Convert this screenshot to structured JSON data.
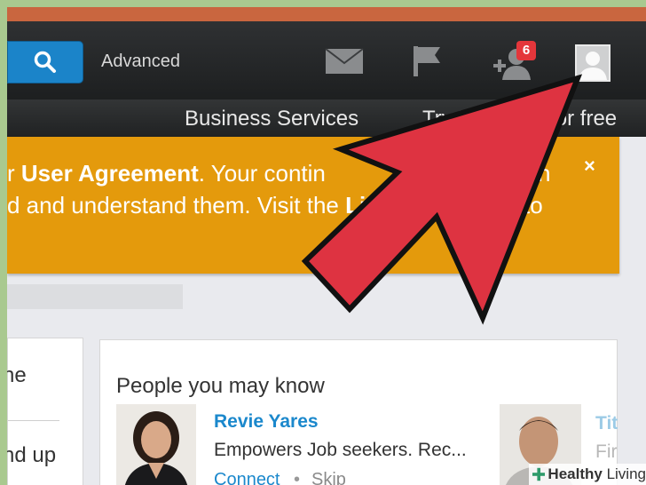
{
  "header": {
    "advanced_label": "Advanced",
    "notification_count": "6",
    "icons": [
      "search-icon",
      "envelope-icon",
      "flag-icon",
      "add-connection-icon",
      "profile-avatar-icon"
    ]
  },
  "nav": {
    "business_services": "Business Services",
    "try_premium": "Try Premium for free"
  },
  "banner": {
    "line1_pre": "r ",
    "line1_bold": "User Agreement",
    "line1_post": ". Your contin",
    "line1_tail": "n",
    "line2_pre": "d and understand them. Visit the ",
    "line2_bold": "Lin",
    "line2_tail": "to",
    "close": "×"
  },
  "left_card": {
    "line1": "he",
    "line2": "nd up"
  },
  "pymk": {
    "title": "People you may know",
    "person1": {
      "name": "Revie Yares",
      "headline": "Empowers Job seekers. Rec...",
      "connect": "Connect",
      "dot": "•",
      "skip": "Skip"
    },
    "person2": {
      "name_partial": "Tit",
      "headline_partial": "Fir"
    }
  },
  "watermark": {
    "brand": "Healthy",
    "brand2": "Living"
  },
  "colors": {
    "accent_blue": "#1b84c9",
    "banner_orange": "#e49a0c",
    "badge_red": "#e4363b",
    "arrow_red": "#de3341"
  }
}
